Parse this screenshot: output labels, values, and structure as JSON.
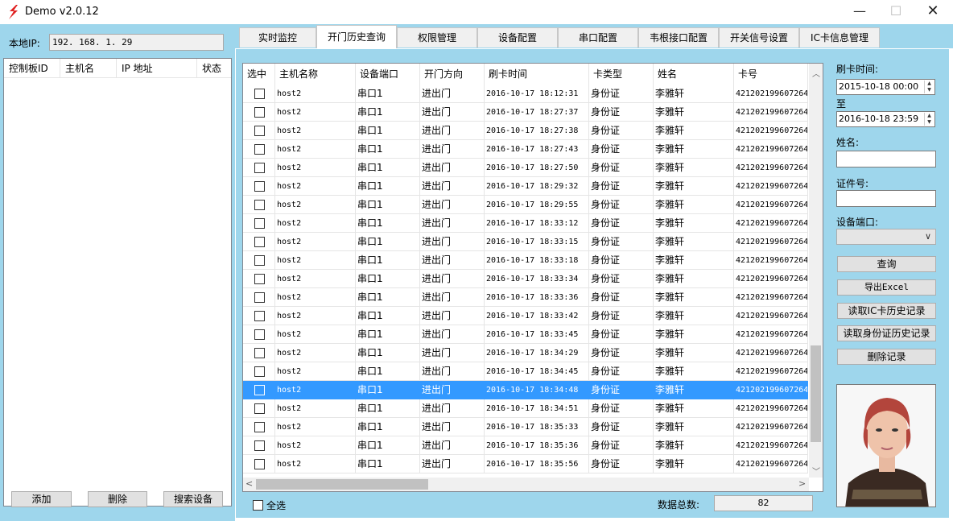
{
  "window": {
    "title": "Demo  v2.0.12",
    "minimize": "—",
    "maximize": "☐",
    "close": "✕"
  },
  "left": {
    "ip_label": "本地IP:",
    "ip_value": "192. 168. 1. 29",
    "columns": [
      "控制板ID",
      "主机名",
      "IP 地址",
      "状态"
    ],
    "buttons": {
      "add": "添加",
      "delete": "删除",
      "search": "搜索设备"
    }
  },
  "tabs": [
    "实时监控",
    "开门历史查询",
    "权限管理",
    "设备配置",
    "串口配置",
    "韦根接口配置",
    "开关信号设置",
    "IC卡信息管理"
  ],
  "active_tab": 1,
  "grid": {
    "columns": [
      "选中",
      "主机名称",
      "设备端口",
      "开门方向",
      "刷卡时间",
      "卡类型",
      "姓名",
      "卡号"
    ],
    "selected_row": 16,
    "rows": [
      [
        "host2",
        "串口1",
        "进出门",
        "2016-10-17 18:12:31",
        "身份证",
        "李雅轩",
        "421202199607264"
      ],
      [
        "host2",
        "串口1",
        "进出门",
        "2016-10-17 18:27:37",
        "身份证",
        "李雅轩",
        "421202199607264"
      ],
      [
        "host2",
        "串口1",
        "进出门",
        "2016-10-17 18:27:38",
        "身份证",
        "李雅轩",
        "421202199607264"
      ],
      [
        "host2",
        "串口1",
        "进出门",
        "2016-10-17 18:27:43",
        "身份证",
        "李雅轩",
        "421202199607264"
      ],
      [
        "host2",
        "串口1",
        "进出门",
        "2016-10-17 18:27:50",
        "身份证",
        "李雅轩",
        "421202199607264"
      ],
      [
        "host2",
        "串口1",
        "进出门",
        "2016-10-17 18:29:32",
        "身份证",
        "李雅轩",
        "421202199607264"
      ],
      [
        "host2",
        "串口1",
        "进出门",
        "2016-10-17 18:29:55",
        "身份证",
        "李雅轩",
        "421202199607264"
      ],
      [
        "host2",
        "串口1",
        "进出门",
        "2016-10-17 18:33:12",
        "身份证",
        "李雅轩",
        "421202199607264"
      ],
      [
        "host2",
        "串口1",
        "进出门",
        "2016-10-17 18:33:15",
        "身份证",
        "李雅轩",
        "421202199607264"
      ],
      [
        "host2",
        "串口1",
        "进出门",
        "2016-10-17 18:33:18",
        "身份证",
        "李雅轩",
        "421202199607264"
      ],
      [
        "host2",
        "串口1",
        "进出门",
        "2016-10-17 18:33:34",
        "身份证",
        "李雅轩",
        "421202199607264"
      ],
      [
        "host2",
        "串口1",
        "进出门",
        "2016-10-17 18:33:36",
        "身份证",
        "李雅轩",
        "421202199607264"
      ],
      [
        "host2",
        "串口1",
        "进出门",
        "2016-10-17 18:33:42",
        "身份证",
        "李雅轩",
        "421202199607264"
      ],
      [
        "host2",
        "串口1",
        "进出门",
        "2016-10-17 18:33:45",
        "身份证",
        "李雅轩",
        "421202199607264"
      ],
      [
        "host2",
        "串口1",
        "进出门",
        "2016-10-17 18:34:29",
        "身份证",
        "李雅轩",
        "421202199607264"
      ],
      [
        "host2",
        "串口1",
        "进出门",
        "2016-10-17 18:34:45",
        "身份证",
        "李雅轩",
        "421202199607264"
      ],
      [
        "host2",
        "串口1",
        "进出门",
        "2016-10-17 18:34:48",
        "身份证",
        "李雅轩",
        "421202199607264"
      ],
      [
        "host2",
        "串口1",
        "进出门",
        "2016-10-17 18:34:51",
        "身份证",
        "李雅轩",
        "421202199607264"
      ],
      [
        "host2",
        "串口1",
        "进出门",
        "2016-10-17 18:35:33",
        "身份证",
        "李雅轩",
        "421202199607264"
      ],
      [
        "host2",
        "串口1",
        "进出门",
        "2016-10-17 18:35:36",
        "身份证",
        "李雅轩",
        "421202199607264"
      ],
      [
        "host2",
        "串口1",
        "进出门",
        "2016-10-17 18:35:56",
        "身份证",
        "李雅轩",
        "421202199607264"
      ]
    ]
  },
  "footer": {
    "select_all": "全选",
    "total_label": "数据总数:",
    "total_value": "82"
  },
  "filter": {
    "time_label": "刷卡时间:",
    "time_from": "2015-10-18 00:00",
    "to_label": "至",
    "time_to": "2016-10-18 23:59",
    "name_label": "姓名:",
    "name_value": "",
    "id_label": "证件号:",
    "id_value": "",
    "port_label": "设备端口:",
    "port_value": "",
    "buttons": {
      "query": "查询",
      "export": "导出Excel",
      "read_ic": "读取IC卡历史记录",
      "read_id": "读取身份证历史记录",
      "delete": "删除记录"
    }
  },
  "colors": {
    "panel": "#9ed6ec",
    "selection": "#3399ff",
    "logo": "#e02020"
  }
}
